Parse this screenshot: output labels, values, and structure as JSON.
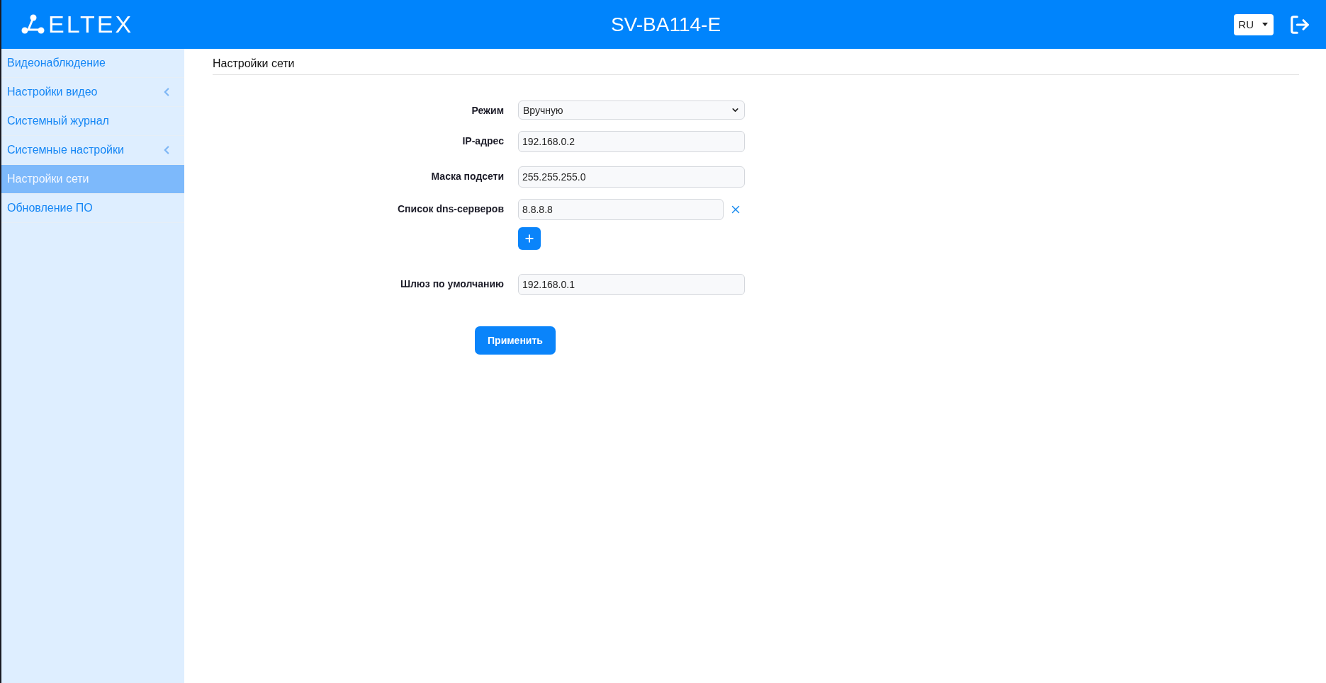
{
  "header": {
    "logo": "ELTEX",
    "title": "SV-BA114-E",
    "language": "RU"
  },
  "sidebar": {
    "items": [
      {
        "label": "Видеонаблюдение",
        "selected": false,
        "expandable": false
      },
      {
        "label": "Настройки видео",
        "selected": false,
        "expandable": true
      },
      {
        "label": "Системный журнал",
        "selected": false,
        "expandable": false
      },
      {
        "label": "Системные настройки",
        "selected": false,
        "expandable": true
      },
      {
        "label": "Настройки сети",
        "selected": true,
        "expandable": false
      },
      {
        "label": "Обновление ПО",
        "selected": false,
        "expandable": false
      }
    ]
  },
  "page": {
    "title": "Настройки сети"
  },
  "form": {
    "fields": [
      {
        "kind": "select",
        "label": "Режим",
        "value": "Вручную"
      },
      {
        "kind": "text",
        "label": "IP-адрес",
        "value": "192.168.0.2"
      },
      {
        "kind": "text",
        "label": "Маска подсети",
        "value": "255.255.255.0"
      },
      {
        "kind": "list",
        "label": "Список dns-серверов",
        "values": [
          "8.8.8.8"
        ]
      },
      {
        "kind": "text",
        "label": "Шлюз по умолчанию",
        "value": "192.168.0.1"
      }
    ],
    "submit": "Применить"
  }
}
